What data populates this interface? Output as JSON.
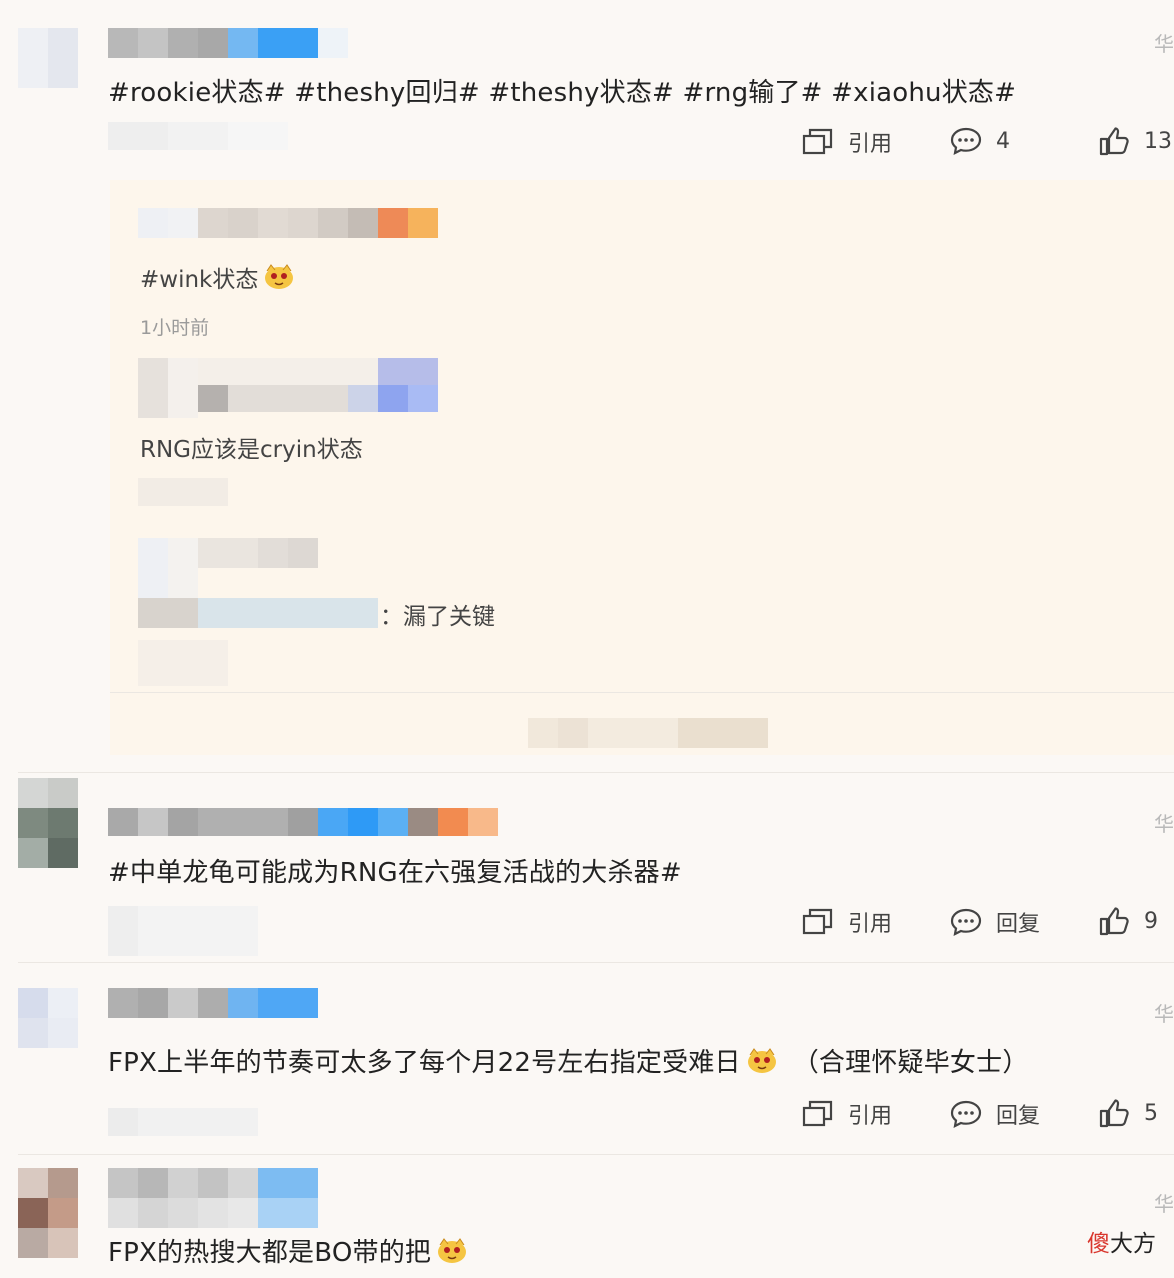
{
  "comments": [
    {
      "text": "#rookie状态# #theshy回归# #theshy状态# #rng输了# #xiaohu状态#",
      "actions": {
        "quote": "引用",
        "reply": "4",
        "like": "13"
      }
    },
    {
      "text": "#中单龙龟可能成为RNG在六强复活战的大杀器#",
      "actions": {
        "quote": "引用",
        "reply": "回复",
        "like": "9"
      }
    },
    {
      "text": "FPX上半年的节奏可太多了每个月22号左右指定受难日",
      "text_suffix": "（合理怀疑毕女士）",
      "actions": {
        "quote": "引用",
        "reply": "回复",
        "like": "5"
      }
    },
    {
      "text": "FPX的热搜大都是BO带的把"
    }
  ],
  "replies": [
    {
      "text": "#wink状态",
      "time": "1小时前"
    },
    {
      "text": "RNG应该是cryin状态"
    },
    {
      "text": "漏了关键",
      "prefix": "："
    }
  ],
  "edge_char": "华",
  "watermark": {
    "red": "傻",
    "rest": "大方"
  },
  "colors": {
    "background": "#fbf8f5",
    "reply_box": "#fdf6ec",
    "text": "#222222"
  },
  "icons": [
    "quote-icon",
    "comment-icon",
    "thumbs-up-icon",
    "emoji-icon"
  ]
}
